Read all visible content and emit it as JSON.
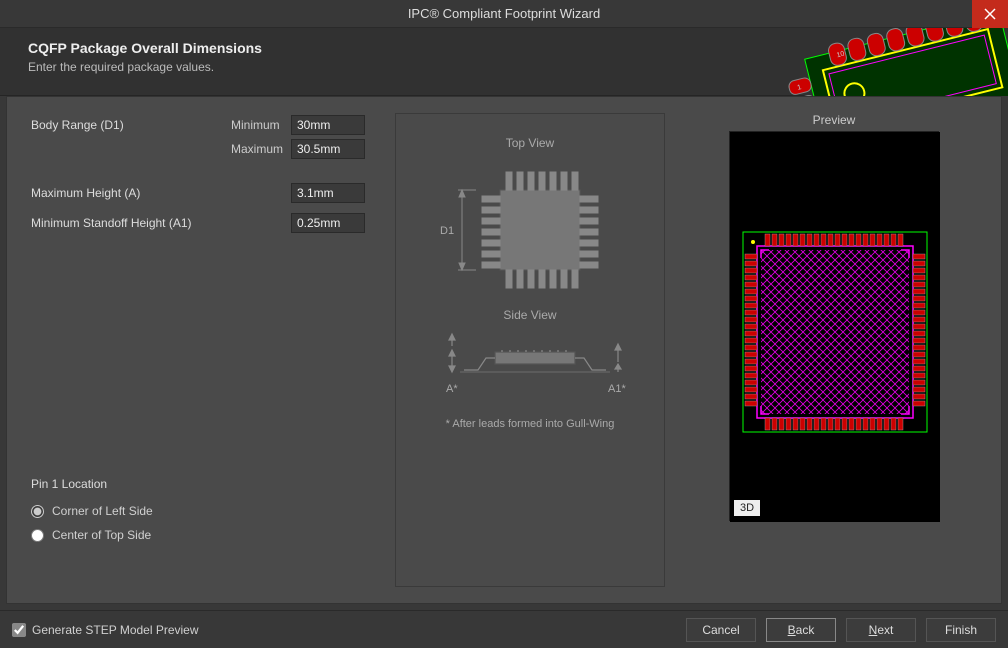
{
  "window": {
    "title": "IPC® Compliant Footprint Wizard"
  },
  "header": {
    "page_title": "CQFP Package Overall Dimensions",
    "subtitle": "Enter the required package values."
  },
  "form": {
    "body_range_label": "Body Range (D1)",
    "minimum_label": "Minimum",
    "maximum_label": "Maximum",
    "body_range_min": "30mm",
    "body_range_max": "30.5mm",
    "max_height_label": "Maximum Height (A)",
    "max_height": "3.1mm",
    "min_standoff_label": "Minimum Standoff Height (A1)",
    "min_standoff": "0.25mm"
  },
  "pin1": {
    "section_label": "Pin 1 Location",
    "option_corner": "Corner of Left Side",
    "option_center": "Center of Top Side",
    "selected": "corner"
  },
  "diagram": {
    "top_view": "Top View",
    "side_view": "Side View",
    "d1": "D1",
    "a_star": "A*",
    "a1_star": "A1*",
    "footnote": "* After leads formed into Gull-Wing"
  },
  "preview": {
    "label": "Preview",
    "mode_badge": "3D"
  },
  "footer": {
    "step_checkbox": "Generate STEP Model Preview",
    "step_checked": true,
    "cancel": "Cancel",
    "back": "Back",
    "next": "Next",
    "finish": "Finish"
  }
}
